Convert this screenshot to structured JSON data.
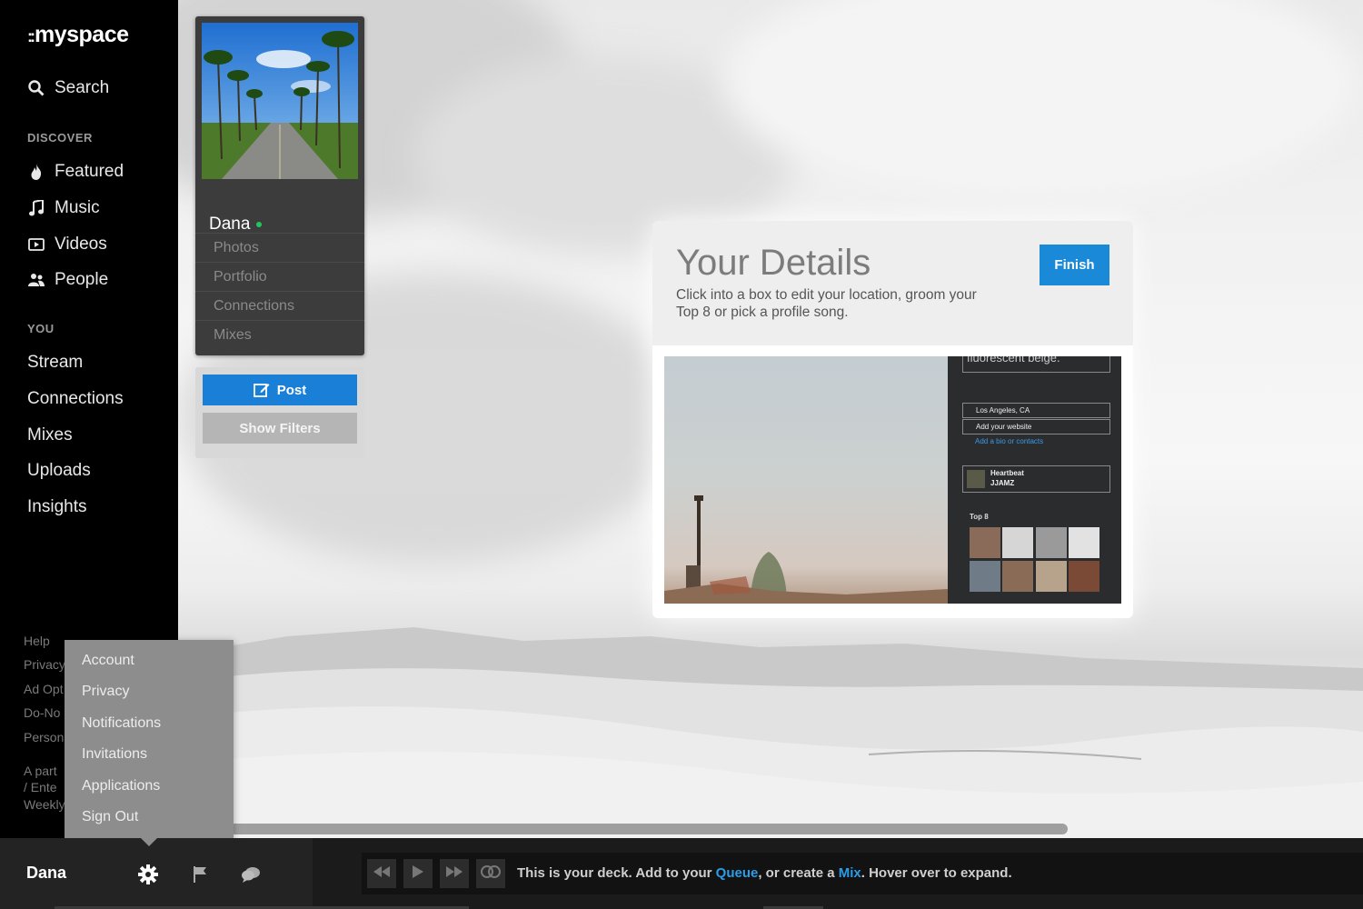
{
  "brand": {
    "logo_text": "myspace",
    "logo_dots": "::"
  },
  "sidebar": {
    "search_label": "Search",
    "discover_heading": "DISCOVER",
    "discover_items": [
      {
        "label": "Featured",
        "icon": "flame-icon"
      },
      {
        "label": "Music",
        "icon": "music-note-icon"
      },
      {
        "label": "Videos",
        "icon": "video-icon"
      },
      {
        "label": "People",
        "icon": "people-icon"
      }
    ],
    "you_heading": "YOU",
    "you_items": [
      "Stream",
      "Connections",
      "Mixes",
      "Uploads",
      "Insights"
    ],
    "footer_fragments": [
      "Help",
      "Privacy",
      "Ad Opt",
      "Do-No",
      "Person",
      "A part",
      "/ Ente",
      "Weekly"
    ]
  },
  "profile": {
    "name": "Dana",
    "online": true,
    "links": [
      "Photos",
      "Portfolio",
      "Connections",
      "Mixes"
    ]
  },
  "actions": {
    "post_label": "Post",
    "filters_label": "Show Filters"
  },
  "details": {
    "title": "Your Details",
    "description": "Click into a box to edit your location, groom your Top 8 or pick a profile song.",
    "finish_label": "Finish",
    "preview": {
      "tagline": "fluorescent beige.",
      "location": "Los Angeles, CA",
      "website_placeholder": "Add your website",
      "bio_link": "Add a bio or contacts",
      "song_title": "Heartbeat",
      "song_artist": "JJAMZ",
      "top8_label": "Top 8"
    }
  },
  "settings_menu": {
    "items": [
      "Account",
      "Privacy",
      "Notifications",
      "Invitations",
      "Applications",
      "Sign Out"
    ]
  },
  "bottom_bar": {
    "user_name": "Dana",
    "deck_text_1": "This is your deck. Add to your ",
    "deck_link_queue": "Queue",
    "deck_text_2": ", or create a ",
    "deck_link_mix": "Mix",
    "deck_text_3": ". Hover over to expand."
  },
  "colors": {
    "accent_blue": "#1a7fd6",
    "online_green": "#22c55e",
    "link_blue": "#2a9de8"
  }
}
